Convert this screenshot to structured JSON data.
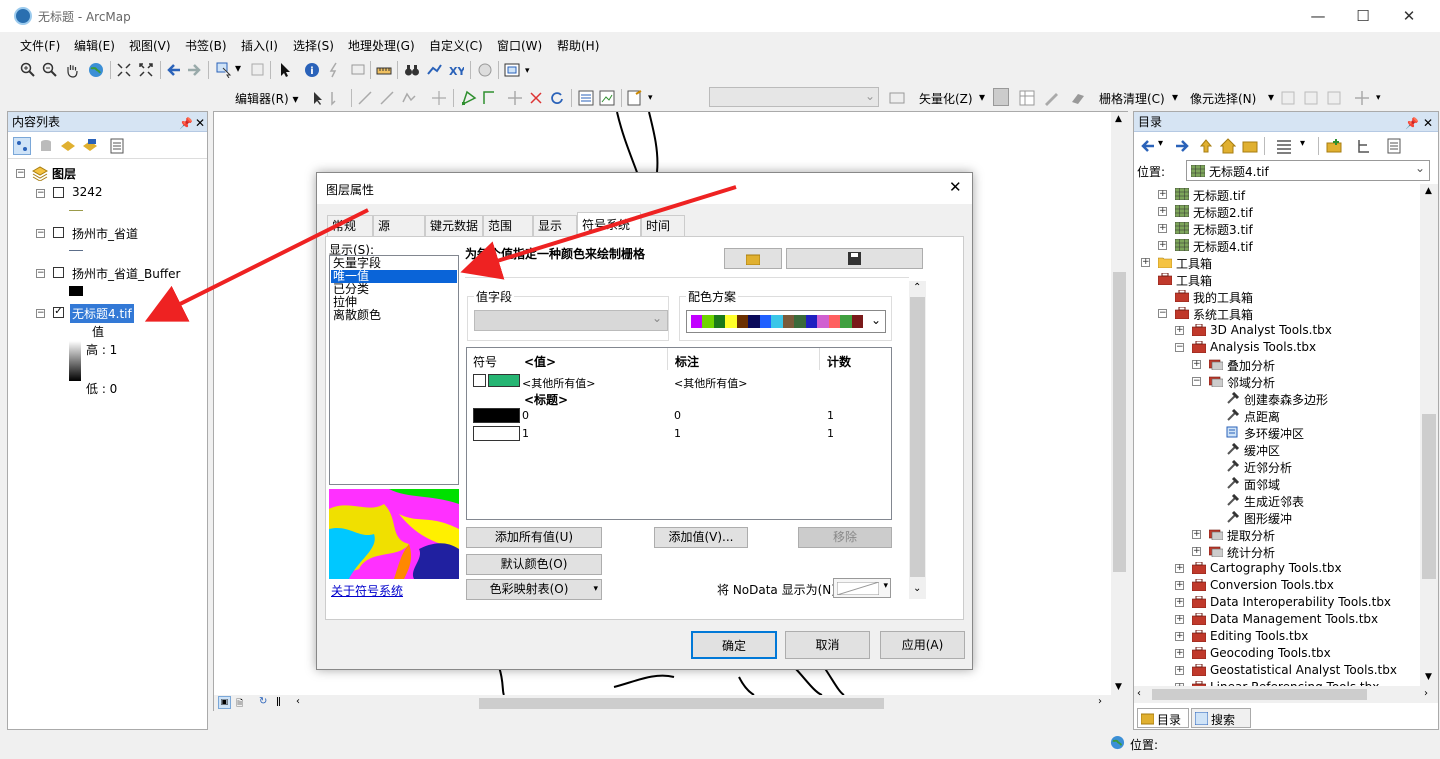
{
  "window": {
    "title": "无标题 - ArcMap"
  },
  "menu": [
    "文件(F)",
    "编辑(E)",
    "视图(V)",
    "书签(B)",
    "插入(I)",
    "选择(S)",
    "地理处理(G)",
    "自定义(C)",
    "窗口(W)",
    "帮助(H)"
  ],
  "toolbar2": {
    "editor": "编辑器(R) ▾",
    "vectorize": "矢量化(Z)",
    "raster_clean": "栅格清理(C)",
    "cell_select": "像元选择(N)"
  },
  "toc": {
    "title": "内容列表",
    "layers_root": "图层",
    "layers": [
      {
        "name": "3242",
        "checked": false
      },
      {
        "name": "扬州市_省道",
        "checked": false
      },
      {
        "name": "扬州市_省道_Buffer",
        "checked": false
      },
      {
        "name": "无标题4.tif",
        "checked": true,
        "selected": true
      }
    ],
    "legend": {
      "label": "值",
      "high": "高 : 1",
      "low": "低 : 0"
    }
  },
  "catalog": {
    "title": "目录",
    "location_label": "位置:",
    "location_value": "无标题4.tif",
    "items": [
      {
        "label": "无标题.tif",
        "indent": 1,
        "type": "raster",
        "expander": "+"
      },
      {
        "label": "无标题2.tif",
        "indent": 1,
        "type": "raster",
        "expander": "+"
      },
      {
        "label": "无标题3.tif",
        "indent": 1,
        "type": "raster",
        "expander": "+"
      },
      {
        "label": "无标题4.tif",
        "indent": 1,
        "type": "raster",
        "expander": "+"
      },
      {
        "label": "工具箱",
        "indent": 0,
        "type": "folder",
        "expander": "+"
      },
      {
        "label": "工具箱",
        "indent": 0,
        "type": "toolbox",
        "expander": ""
      },
      {
        "label": "我的工具箱",
        "indent": 1,
        "type": "toolbox",
        "expander": ""
      },
      {
        "label": "系统工具箱",
        "indent": 1,
        "type": "toolbox",
        "expander": "−"
      },
      {
        "label": "3D Analyst Tools.tbx",
        "indent": 2,
        "type": "tbx",
        "expander": "+"
      },
      {
        "label": "Analysis Tools.tbx",
        "indent": 2,
        "type": "tbx",
        "expander": "−"
      },
      {
        "label": "叠加分析",
        "indent": 3,
        "type": "toolset",
        "expander": "+"
      },
      {
        "label": "邻域分析",
        "indent": 3,
        "type": "toolset",
        "expander": "−"
      },
      {
        "label": "创建泰森多边形",
        "indent": 4,
        "type": "tool",
        "expander": ""
      },
      {
        "label": "点距离",
        "indent": 4,
        "type": "tool",
        "expander": ""
      },
      {
        "label": "多环缓冲区",
        "indent": 4,
        "type": "script",
        "expander": ""
      },
      {
        "label": "缓冲区",
        "indent": 4,
        "type": "tool",
        "expander": ""
      },
      {
        "label": "近邻分析",
        "indent": 4,
        "type": "tool",
        "expander": ""
      },
      {
        "label": "面邻域",
        "indent": 4,
        "type": "tool",
        "expander": ""
      },
      {
        "label": "生成近邻表",
        "indent": 4,
        "type": "tool",
        "expander": ""
      },
      {
        "label": "图形缓冲",
        "indent": 4,
        "type": "tool",
        "expander": ""
      },
      {
        "label": "提取分析",
        "indent": 3,
        "type": "toolset",
        "expander": "+"
      },
      {
        "label": "统计分析",
        "indent": 3,
        "type": "toolset",
        "expander": "+"
      },
      {
        "label": "Cartography Tools.tbx",
        "indent": 2,
        "type": "tbx",
        "expander": "+"
      },
      {
        "label": "Conversion Tools.tbx",
        "indent": 2,
        "type": "tbx",
        "expander": "+"
      },
      {
        "label": "Data Interoperability Tools.tbx",
        "indent": 2,
        "type": "tbx",
        "expander": "+"
      },
      {
        "label": "Data Management Tools.tbx",
        "indent": 2,
        "type": "tbx",
        "expander": "+"
      },
      {
        "label": "Editing Tools.tbx",
        "indent": 2,
        "type": "tbx",
        "expander": "+"
      },
      {
        "label": "Geocoding Tools.tbx",
        "indent": 2,
        "type": "tbx",
        "expander": "+"
      },
      {
        "label": "Geostatistical Analyst Tools.tbx",
        "indent": 2,
        "type": "tbx",
        "expander": "+"
      },
      {
        "label": "Linear Referencing Tools.tbx",
        "indent": 2,
        "type": "tbx",
        "expander": "+"
      }
    ],
    "tabs": [
      "目录",
      "搜索"
    ]
  },
  "dialog": {
    "title": "图层属性",
    "tabs": [
      "常规",
      "源",
      "键元数据",
      "范围",
      "显示",
      "符号系统",
      "时间"
    ],
    "active_tab": "符号系统",
    "show_label": "显示(S):",
    "show_options": [
      "矢量字段",
      "唯一值",
      "已分类",
      "拉伸",
      "离散颜色"
    ],
    "selected_option": "唯一值",
    "heading": "为每个值指定一种颜色来绘制栅格",
    "value_field_label": "值字段",
    "color_scheme_label": "配色方案",
    "color_scheme": [
      "#c200ff",
      "#6ed400",
      "#1a7a1a",
      "#ffff2a",
      "#6b2f00",
      "#0a0a5a",
      "#2060ff",
      "#3ac6e8",
      "#7a5a3a",
      "#3a6a3a",
      "#2020c0",
      "#d060d0",
      "#ff6060",
      "#40a040",
      "#7a1a1a"
    ],
    "table_headers": {
      "symbol": "符号",
      "value": "<值>",
      "label": "标注",
      "count": "计数"
    },
    "rows": [
      {
        "symbol_color": "#26b573",
        "value": "<其他所有值>",
        "label": "<其他所有值>",
        "count": ""
      },
      {
        "symbol_color": "",
        "value": "<标题>",
        "label": "",
        "count": ""
      },
      {
        "symbol_color": "#000000",
        "value": "0",
        "label": "0",
        "count": "1"
      },
      {
        "symbol_color": "#ffffff",
        "value": "1",
        "label": "1",
        "count": "1"
      }
    ],
    "buttons": {
      "add_all": "添加所有值(U)",
      "add_values": "添加值(V)...",
      "remove": "移除",
      "default_colors": "默认颜色(O)",
      "colormap": "色彩映射表(O)",
      "ok": "确定",
      "cancel": "取消",
      "apply": "应用(A)"
    },
    "about_link": "关于符号系统",
    "nodata_label": "将 NoData 显示为(N)"
  },
  "status": {
    "location": "位置:"
  }
}
